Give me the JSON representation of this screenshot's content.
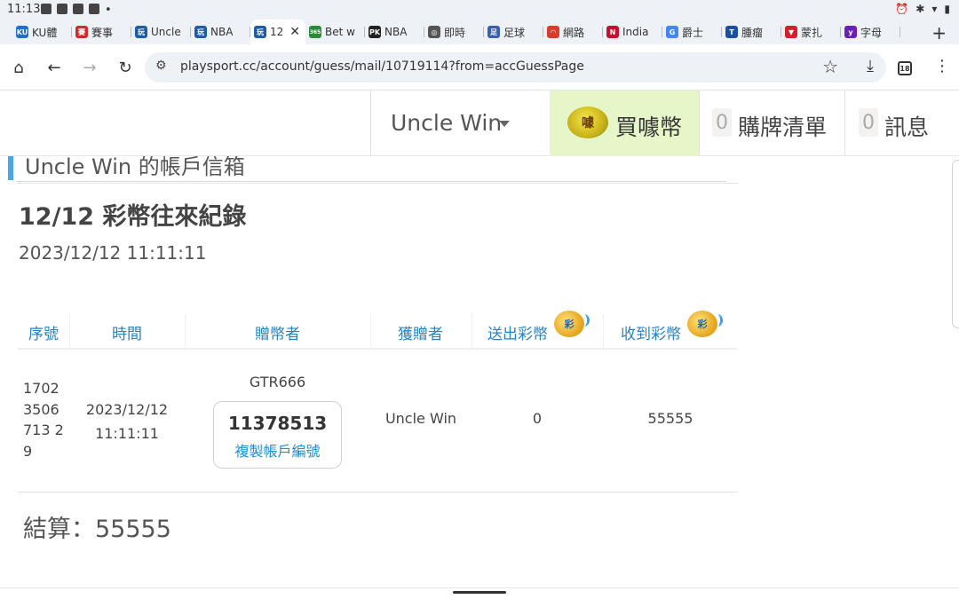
{
  "status_bar": {
    "time": "11:13",
    "icons": [
      "alarm-icon",
      "bluetooth-icon",
      "wifi-icon",
      "battery-icon"
    ]
  },
  "tabs": [
    {
      "label": "KU體",
      "icon_color": "#1f6fd1",
      "icon_text": "KU"
    },
    {
      "label": "賽事",
      "icon_color": "#d02a2a",
      "icon_text": "賽"
    },
    {
      "label": "Uncle",
      "icon_color": "#1e5ca8",
      "icon_text": "玩"
    },
    {
      "label": "NBA",
      "icon_color": "#1e5ca8",
      "icon_text": "玩"
    },
    {
      "label": "12",
      "icon_color": "#1e5ca8",
      "icon_text": "玩"
    },
    {
      "label": "Bet w",
      "icon_color": "#2a8a3a",
      "icon_text": "365"
    },
    {
      "label": "NBA",
      "icon_color": "#222222",
      "icon_text": "PK"
    },
    {
      "label": "即時",
      "icon_color": "#555555",
      "icon_text": "◎"
    },
    {
      "label": "足球",
      "icon_color": "#3a5fb0",
      "icon_text": "足"
    },
    {
      "label": "網路",
      "icon_color": "#d93c2a",
      "icon_text": "◠"
    },
    {
      "label": "India",
      "icon_color": "#c8102e",
      "icon_text": "N"
    },
    {
      "label": "爵士",
      "icon_color": "#4285f4",
      "icon_text": "G"
    },
    {
      "label": "腫瘤",
      "icon_color": "#1b4fa3",
      "icon_text": "T"
    },
    {
      "label": "蒙扎",
      "icon_color": "#d4202a",
      "icon_text": "▼"
    },
    {
      "label": "字母",
      "icon_color": "#6a1fb5",
      "icon_text": "y"
    }
  ],
  "browser": {
    "url": "playsport.cc/account/guess/mail/10719114?from=accGuessPage",
    "tab_count": "18"
  },
  "header": {
    "user_name": "Uncle Win",
    "coin_icon_text": "噱",
    "buy_label": "買噱幣",
    "cart_count": "0",
    "cart_label": "購牌清單",
    "msg_count": "0",
    "msg_label": "訊息"
  },
  "page": {
    "mailbox_title": "Uncle Win 的帳戶信箱",
    "record_title": "12/12 彩幣往來紀錄",
    "record_datetime": "2023/12/12 11:11:11",
    "coin_badge_text": "彩"
  },
  "table": {
    "headers": [
      "序號",
      "時間",
      "贈幣者",
      "獲贈者",
      "送出彩幣",
      "收到彩幣"
    ],
    "rows": [
      {
        "serial": "17023506713 29",
        "time": "2023/12/12 11:11:11",
        "giver_name": "GTR666",
        "giver_id": "11378513",
        "copy_label": "複製帳戶編號",
        "receiver": "Uncle Win",
        "sent": "0",
        "received": "55555"
      }
    ]
  },
  "summary": {
    "label": "結算：55555"
  }
}
